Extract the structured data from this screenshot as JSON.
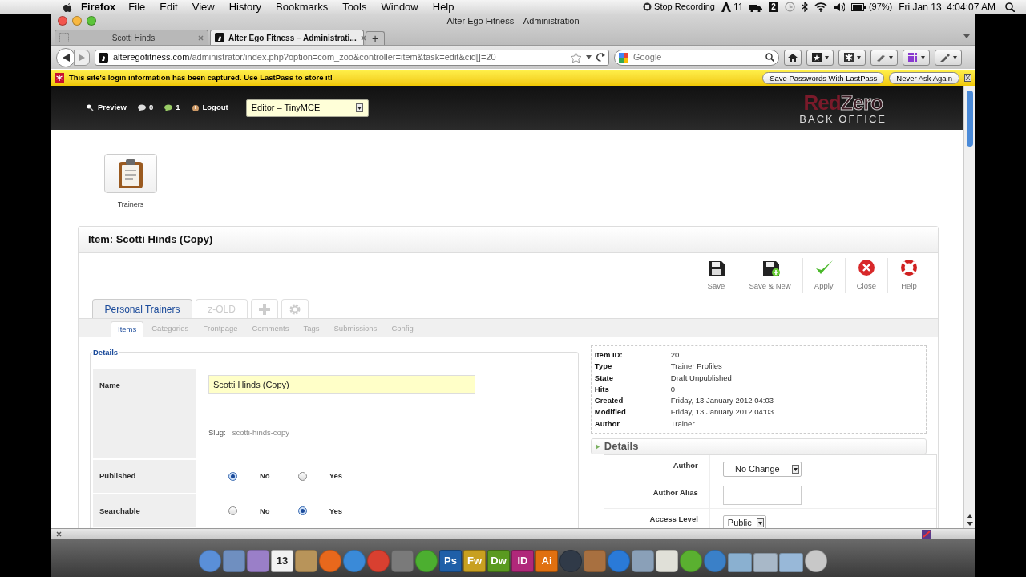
{
  "menu_bar": {
    "app": "Firefox",
    "menus": [
      "File",
      "Edit",
      "View",
      "History",
      "Bookmarks",
      "Tools",
      "Window",
      "Help"
    ],
    "recording": "Stop Recording",
    "adobe_updates": "11",
    "space": "2",
    "battery": "(97%)",
    "clock": "Fri Jan 13  4:04:07 AM"
  },
  "window": {
    "title": "Alter Ego Fitness – Administration"
  },
  "tabs": [
    {
      "label": "Scotti Hinds",
      "selected": false
    },
    {
      "label": "Alter Ego Fitness – Administrati...",
      "selected": true
    }
  ],
  "new_tab": "+",
  "address_bar": {
    "domain": "alteregofitness.com",
    "path": "/administrator/index.php?option=com_zoo&controller=item&task=edit&cid[]=20"
  },
  "search": {
    "placeholder": "Google"
  },
  "lastpass_bar": {
    "message": "This site's login information has been captured. Use LastPass to store it!",
    "buttons": [
      "Save Passwords With LastPass",
      "Never Ask Again"
    ]
  },
  "admin_bar": {
    "links": [
      {
        "kind": "preview",
        "label": "Preview"
      },
      {
        "kind": "comments",
        "label": "0"
      },
      {
        "kind": "messages",
        "label": "1"
      },
      {
        "kind": "logout",
        "label": "Logout"
      }
    ],
    "editor_select": "Editor – TinyMCE",
    "logo": {
      "red": "Red",
      "zero": "Zero",
      "sub": "BACK OFFICE"
    }
  },
  "app_icon": {
    "label": "Trainers"
  },
  "item_title": "Item: Scotti Hinds (Copy)",
  "toolbar": [
    {
      "kind": "save",
      "label": "Save"
    },
    {
      "kind": "save_new",
      "label": "Save & New"
    },
    {
      "kind": "apply",
      "label": "Apply"
    },
    {
      "kind": "close",
      "label": "Close"
    },
    {
      "kind": "help",
      "label": "Help"
    }
  ],
  "app_tabs": [
    {
      "kind": "text",
      "label": "Personal Trainers",
      "selected": true
    },
    {
      "kind": "text",
      "label": "z-OLD",
      "selected": false
    },
    {
      "kind": "add",
      "selected": false
    },
    {
      "kind": "settings",
      "selected": false
    }
  ],
  "sub_tabs": [
    {
      "label": "Items",
      "selected": true
    },
    {
      "label": "Categories",
      "selected": false
    },
    {
      "label": "Frontpage",
      "selected": false
    },
    {
      "label": "Comments",
      "selected": false
    },
    {
      "label": "Tags",
      "selected": false
    },
    {
      "label": "Submissions",
      "selected": false
    },
    {
      "label": "Config",
      "selected": false
    }
  ],
  "details_form": {
    "legend": "Details",
    "name_label": "Name",
    "name_value": "Scotti Hinds (Copy)",
    "slug_label": "Slug:",
    "slug_value": "scotti-hinds-copy",
    "radios": [
      {
        "label": "Published",
        "options": [
          {
            "label": "No",
            "selected": true
          },
          {
            "label": "Yes",
            "selected": false
          }
        ]
      },
      {
        "label": "Searchable",
        "options": [
          {
            "label": "No",
            "selected": false
          },
          {
            "label": "Yes",
            "selected": true
          }
        ]
      }
    ]
  },
  "info": [
    {
      "label": "Item ID:",
      "value": "20"
    },
    {
      "label": "Type",
      "value": "Trainer Profiles"
    },
    {
      "label": "State",
      "value": "Draft Unpublished"
    },
    {
      "label": "Hits",
      "value": "0"
    },
    {
      "label": "Created",
      "value": "Friday, 13 January 2012 04:03"
    },
    {
      "label": "Modified",
      "value": "Friday, 13 January 2012 04:03"
    },
    {
      "label": "Author",
      "value": "Trainer"
    }
  ],
  "details_panel": {
    "title": "Details",
    "fields": [
      {
        "kind": "select",
        "label": "Author",
        "value": "– No Change –"
      },
      {
        "kind": "input",
        "label": "Author Alias"
      },
      {
        "kind": "select",
        "label": "Access Level",
        "value": "Public"
      }
    ]
  },
  "dock": [
    {
      "kind": "round",
      "color": "#5a8fd8"
    },
    {
      "kind": "square",
      "color": "#6f8fc0"
    },
    {
      "kind": "square",
      "color": "#9a7fc8"
    },
    {
      "kind": "tile",
      "label": "13",
      "color": "#f2f2f2"
    },
    {
      "kind": "square",
      "color": "#b8945a"
    },
    {
      "kind": "round",
      "color": "#e8681c"
    },
    {
      "kind": "round",
      "color": "#3a8ad8"
    },
    {
      "kind": "round",
      "color": "#d94030"
    },
    {
      "kind": "square",
      "color": "#7a7a7a"
    },
    {
      "kind": "round",
      "color": "#4caf30"
    },
    {
      "kind": "tile",
      "label": "Ps",
      "color": "#1f5fa8"
    },
    {
      "kind": "tile",
      "label": "Fw",
      "color": "#c8a020"
    },
    {
      "kind": "tile",
      "label": "Dw",
      "color": "#5a9a20"
    },
    {
      "kind": "tile",
      "label": "ID",
      "color": "#b0287a"
    },
    {
      "kind": "tile",
      "label": "Ai",
      "color": "#e07010"
    },
    {
      "kind": "round",
      "color": "#303a48"
    },
    {
      "kind": "square",
      "color": "#a87040"
    },
    {
      "kind": "round",
      "color": "#2a7ad8"
    },
    {
      "kind": "square",
      "color": "#8aa0b8"
    },
    {
      "kind": "square",
      "color": "#e0e0d8"
    },
    {
      "kind": "round",
      "color": "#5ab030"
    },
    {
      "kind": "round",
      "color": "#3a80c8"
    },
    {
      "kind": "folder",
      "color": "#8ab0d0"
    },
    {
      "kind": "folder",
      "color": "#a8b8c8"
    },
    {
      "kind": "folder",
      "color": "#98b8d8"
    },
    {
      "kind": "round",
      "color": "#c8c8c8"
    }
  ]
}
